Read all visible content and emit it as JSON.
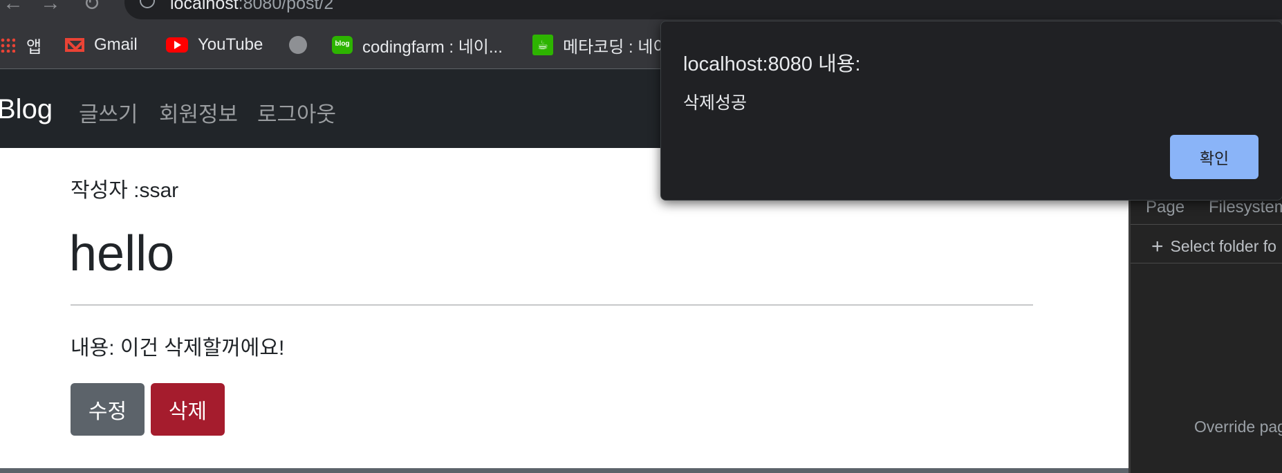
{
  "browser": {
    "url_host": "localhost",
    "url_path": ":8080/post/2",
    "bookmarks": [
      {
        "label": "앱",
        "icon": "apps-grid-icon"
      },
      {
        "label": "Gmail",
        "icon": "gmail-icon"
      },
      {
        "label": "YouTube",
        "icon": "youtube-icon"
      },
      {
        "label": "",
        "icon": "globe-icon"
      },
      {
        "label": "codingfarm : 네이...",
        "icon": "naver-blog-icon"
      },
      {
        "label": "메타코딩 : 네이",
        "icon": "naver-cafe-icon"
      }
    ]
  },
  "navbar": {
    "brand": "Blog",
    "links": [
      "글쓰기",
      "회원정보",
      "로그아웃"
    ]
  },
  "post": {
    "author_label": "작성자 :ssar",
    "title": "hello",
    "content": "내용: 이건 삭제할꺼에요!",
    "edit_label": "수정",
    "delete_label": "삭제"
  },
  "devtools": {
    "tabs": [
      "Page",
      "Filesystem"
    ],
    "select_folder": "Select folder fo",
    "override_text": "Override pag"
  },
  "dialog": {
    "title": "localhost:8080 내용:",
    "message": "삭제성공",
    "ok_label": "확인"
  },
  "colors": {
    "navbar_bg": "#212529",
    "edit_button": "#5c636a",
    "delete_button": "#a51c2d",
    "dialog_bg": "#202124",
    "dialog_ok": "#8ab4f8"
  }
}
